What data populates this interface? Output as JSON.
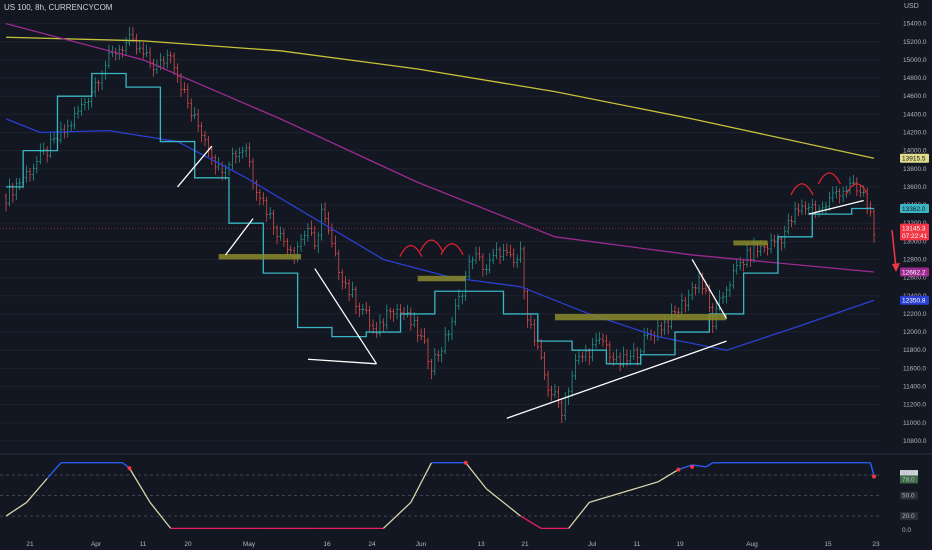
{
  "header": {
    "title": "US 100, 8h, CURRENCYCOM",
    "currency": "USD"
  },
  "chart_data": [
    {
      "type": "candlestick",
      "x_ticks": [
        "21",
        "Apr",
        "11",
        "20",
        "May",
        "16",
        "24",
        "Jun",
        "13",
        "21",
        "Jul",
        "11",
        "19",
        "Aug",
        "15",
        "23"
      ],
      "y_ticks": [
        "15400.0",
        "15200.0",
        "15000.0",
        "14800.0",
        "14600.0",
        "14400.0",
        "14200.0",
        "14000.0",
        "13800.0",
        "13600.0",
        "13400.0",
        "13200.0",
        "13000.0",
        "12800.0",
        "12600.0",
        "12400.0",
        "12200.0",
        "12000.0",
        "11800.0",
        "11600.0",
        "11400.0",
        "11200.0",
        "11000.0",
        "10800.0"
      ],
      "ylim": [
        10700,
        15550
      ],
      "close_path": [
        [
          0,
          13500
        ],
        [
          6,
          13750
        ],
        [
          12,
          14000
        ],
        [
          18,
          14250
        ],
        [
          24,
          14600
        ],
        [
          28,
          14900
        ],
        [
          32,
          15100
        ],
        [
          36,
          15200
        ],
        [
          40,
          15050
        ],
        [
          44,
          14900
        ],
        [
          48,
          15100
        ],
        [
          50,
          14850
        ],
        [
          54,
          14400
        ],
        [
          58,
          14150
        ],
        [
          62,
          13800
        ],
        [
          66,
          13950
        ],
        [
          70,
          14050
        ],
        [
          72,
          13700
        ],
        [
          76,
          13350
        ],
        [
          80,
          13050
        ],
        [
          84,
          12900
        ],
        [
          88,
          13150
        ],
        [
          90,
          12900
        ],
        [
          92,
          13350
        ],
        [
          96,
          12800
        ],
        [
          100,
          12450
        ],
        [
          104,
          12250
        ],
        [
          108,
          11950
        ],
        [
          112,
          12300
        ],
        [
          116,
          12200
        ],
        [
          120,
          12000
        ],
        [
          124,
          11650
        ],
        [
          128,
          11900
        ],
        [
          132,
          12350
        ],
        [
          136,
          12850
        ],
        [
          140,
          12700
        ],
        [
          144,
          12900
        ],
        [
          148,
          12750
        ],
        [
          150,
          12850
        ],
        [
          152,
          12200
        ],
        [
          154,
          11900
        ],
        [
          158,
          11400
        ],
        [
          162,
          11150
        ],
        [
          166,
          11650
        ],
        [
          170,
          11800
        ],
        [
          174,
          11900
        ],
        [
          178,
          11650
        ],
        [
          182,
          11700
        ],
        [
          186,
          11900
        ],
        [
          190,
          12050
        ],
        [
          194,
          12150
        ],
        [
          198,
          12350
        ],
        [
          202,
          12600
        ],
        [
          204,
          12400
        ],
        [
          206,
          12100
        ],
        [
          210,
          12500
        ],
        [
          214,
          12750
        ],
        [
          218,
          12900
        ],
        [
          222,
          12950
        ],
        [
          226,
          13050
        ],
        [
          230,
          13300
        ],
        [
          234,
          13400
        ],
        [
          238,
          13350
        ],
        [
          242,
          13550
        ],
        [
          246,
          13600
        ],
        [
          250,
          13500
        ],
        [
          252,
          13300
        ],
        [
          253,
          13145.3
        ]
      ],
      "ma_lines": [
        {
          "name": "MA yellow",
          "color": "#c8c23a",
          "points": [
            [
              0,
              15250
            ],
            [
              40,
              15210
            ],
            [
              80,
              15100
            ],
            [
              120,
              14900
            ],
            [
              160,
              14650
            ],
            [
              200,
              14350
            ],
            [
              253,
              13915.5
            ]
          ],
          "last_label": "13915.5"
        },
        {
          "name": "MA purple",
          "color": "#9c2a8f",
          "points": [
            [
              0,
              15400
            ],
            [
              40,
              15000
            ],
            [
              80,
              14350
            ],
            [
              120,
              13650
            ],
            [
              160,
              13050
            ],
            [
              200,
              12850
            ],
            [
              253,
              12662.2
            ]
          ],
          "last_label": "12662.2"
        },
        {
          "name": "MA blue",
          "color": "#2a3fd1",
          "points": [
            [
              0,
              14350
            ],
            [
              10,
              14200
            ],
            [
              30,
              14220
            ],
            [
              50,
              14100
            ],
            [
              70,
              13700
            ],
            [
              90,
              13250
            ],
            [
              110,
              12800
            ],
            [
              130,
              12600
            ],
            [
              150,
              12500
            ],
            [
              170,
              12200
            ],
            [
              190,
              11950
            ],
            [
              210,
              11800
            ],
            [
              230,
              12050
            ],
            [
              253,
              12350.8
            ]
          ],
          "last_label": "12350.8"
        },
        {
          "name": "MA cyan",
          "color": "#3ab6c2",
          "points": [
            [
              0,
              13600
            ],
            [
              10,
              14000
            ],
            [
              20,
              14600
            ],
            [
              30,
              14850
            ],
            [
              40,
              14700
            ],
            [
              50,
              14100
            ],
            [
              60,
              13700
            ],
            [
              70,
              13200
            ],
            [
              80,
              12650
            ],
            [
              90,
              12050
            ],
            [
              100,
              11950
            ],
            [
              110,
              12000
            ],
            [
              120,
              12200
            ],
            [
              130,
              12450
            ],
            [
              140,
              12450
            ],
            [
              150,
              12200
            ],
            [
              160,
              11900
            ],
            [
              170,
              11800
            ],
            [
              180,
              11650
            ],
            [
              190,
              11750
            ],
            [
              200,
              12000
            ],
            [
              210,
              12200
            ],
            [
              220,
              12650
            ],
            [
              230,
              13050
            ],
            [
              240,
              13300
            ],
            [
              253,
              13362
            ]
          ],
          "last_label": "13362.0"
        }
      ],
      "price_tags": [
        {
          "label": "13915.5",
          "bg": "#e0dc8a",
          "fg": "#131722",
          "y": 13915.5
        },
        {
          "label": "13362.0",
          "bg": "#3ab6c2",
          "fg": "#131722",
          "y": 13362.0
        },
        {
          "label": "13145.3",
          "bg": "#f23645",
          "fg": "#ffffff",
          "y": 13145.3
        },
        {
          "label": "07:22:41",
          "bg": "#f23645",
          "fg": "#ffffff",
          "y": 13060
        },
        {
          "label": "12662.2",
          "bg": "#9c2a8f",
          "fg": "#ffffff",
          "y": 12662.2
        },
        {
          "label": "12350.8",
          "bg": "#2a3fd1",
          "fg": "#ffffff",
          "y": 12350.8
        }
      ],
      "annotations": {
        "trendlines": [
          [
            [
              50,
              13600
            ],
            [
              60,
              14050
            ]
          ],
          [
            [
              64,
              12850
            ],
            [
              72,
              13250
            ]
          ],
          [
            [
              90,
              12700
            ],
            [
              108,
              11650
            ]
          ],
          [
            [
              88,
              11700
            ],
            [
              108,
              11650
            ]
          ],
          [
            [
              146,
              11050
            ],
            [
              210,
              11900
            ]
          ],
          [
            [
              200,
              12800
            ],
            [
              210,
              12150
            ]
          ],
          [
            [
              234,
              13300
            ],
            [
              250,
              13450
            ]
          ]
        ],
        "zones": [
          [
            [
              62,
              12860
            ],
            [
              86,
              12800
            ]
          ],
          [
            [
              120,
              12620
            ],
            [
              134,
              12560
            ]
          ],
          [
            [
              160,
              12200
            ],
            [
              210,
              12130
            ]
          ],
          [
            [
              212,
              13010
            ],
            [
              222,
              12970
            ]
          ]
        ],
        "arcs": [
          [
            118,
            12920
          ],
          [
            124,
            12980
          ],
          [
            130,
            12940
          ],
          [
            232,
            13600
          ],
          [
            240,
            13720
          ],
          [
            248,
            13600
          ]
        ]
      }
    },
    {
      "type": "line",
      "name": "oscillator",
      "ylim": [
        -15,
        105
      ],
      "y_ticks": [
        "80.0",
        "78.0",
        "50.0",
        "20.0",
        "0.0"
      ],
      "series": [
        [
          0,
          20
        ],
        [
          6,
          40
        ],
        [
          12,
          75
        ],
        [
          16,
          98
        ],
        [
          34,
          98
        ],
        [
          36,
          90
        ],
        [
          42,
          40
        ],
        [
          48,
          2
        ],
        [
          74,
          2
        ],
        [
          90,
          2
        ],
        [
          110,
          2
        ],
        [
          118,
          40
        ],
        [
          124,
          98
        ],
        [
          134,
          98
        ],
        [
          140,
          60
        ],
        [
          150,
          20
        ],
        [
          156,
          2
        ],
        [
          164,
          2
        ],
        [
          170,
          40
        ],
        [
          180,
          55
        ],
        [
          190,
          70
        ],
        [
          196,
          88
        ],
        [
          200,
          95
        ],
        [
          204,
          92
        ],
        [
          206,
          98
        ],
        [
          252,
          98
        ],
        [
          253,
          78
        ]
      ],
      "markers": [
        [
          36,
          90
        ],
        [
          134,
          98
        ],
        [
          196,
          88
        ],
        [
          200,
          92
        ],
        [
          253,
          78
        ]
      ]
    }
  ]
}
